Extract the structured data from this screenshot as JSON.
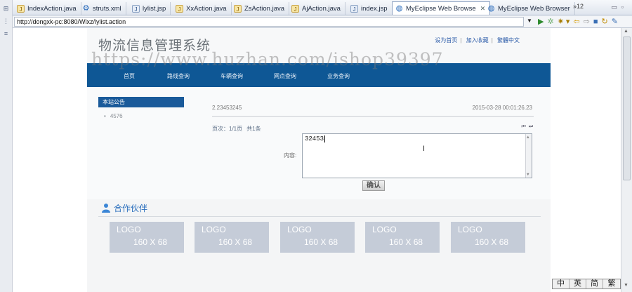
{
  "tabs": [
    {
      "label": "IndexAction.java",
      "icon": "java-file-icon",
      "active": false
    },
    {
      "label": "struts.xml",
      "icon": "gear-icon",
      "active": false
    },
    {
      "label": "lylist.jsp",
      "icon": "jsp-file-icon",
      "active": false
    },
    {
      "label": "XxAction.java",
      "icon": "java-file-icon",
      "active": false
    },
    {
      "label": "ZsAction.java",
      "icon": "java-file-icon",
      "active": false
    },
    {
      "label": "AjAction.java",
      "icon": "java-file-icon",
      "active": false
    },
    {
      "label": "index.jsp",
      "icon": "jsp-file-icon",
      "active": false
    },
    {
      "label": "MyEclipse Web Browse",
      "icon": "globe-icon",
      "active": true
    },
    {
      "label": "MyEclipse Web Browser",
      "icon": "globe-icon",
      "active": false
    }
  ],
  "tab_overflow": "»12",
  "address": {
    "url": "http://dongxk-pc:8080/Wlxz/lylist.action"
  },
  "site": {
    "title": "物流信息管理系统",
    "toplinks": [
      "设为首页",
      "加入收藏",
      "繁體中文"
    ],
    "watermark": "https://www.huzhan.com/ishop39397"
  },
  "nav": [
    "首页",
    "路线查询",
    "车辆查询",
    "网点查询",
    "业务查询"
  ],
  "announcement": {
    "header": "本站公告",
    "items": [
      "4576"
    ]
  },
  "post": {
    "title": "2.23453245",
    "date": "2015-03-28 00:01:26.23"
  },
  "pager": {
    "pages": "页次：1/1页",
    "count": "共1条",
    "nav": "⏮ ⏭"
  },
  "form": {
    "content_label": "内容:",
    "content_value": "32453",
    "confirm_label": "确认"
  },
  "partners": {
    "title": "合作伙伴",
    "logos": [
      {
        "line1": "LOGO",
        "line2": "160 X 68"
      },
      {
        "line1": "LOGO",
        "line2": "160 X 68"
      },
      {
        "line1": "LOGO",
        "line2": "160 X 68"
      },
      {
        "line1": "LOGO",
        "line2": "160 X 68"
      },
      {
        "line1": "LOGO",
        "line2": "160 X 68"
      }
    ]
  },
  "ime": [
    "中",
    "英",
    "简",
    "繁"
  ]
}
